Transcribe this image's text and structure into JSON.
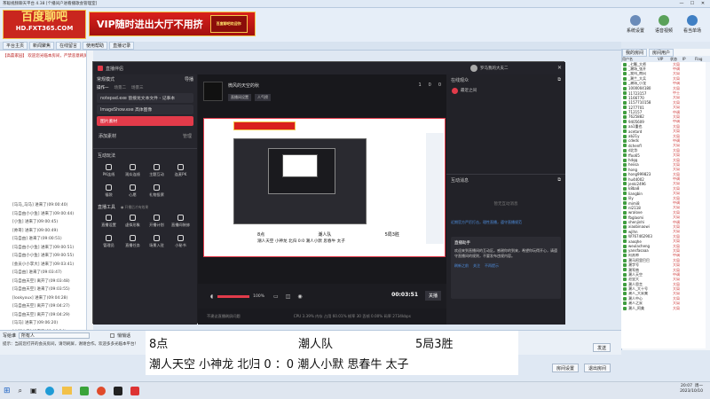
{
  "app": {
    "title": "茶聪视频聊天平台 4.38 [个播间户进看播歌会管理室]",
    "logo_line1": "百度聊吧",
    "logo_line2": "HD.FXT365.COM",
    "promo_main": "VIP随时进出大厅不用挤",
    "promo_sub": "百度聊吧欢迎你"
  },
  "toptools": [
    {
      "label": "系统设置",
      "icon": "gear-icon"
    },
    {
      "label": "语音视频",
      "icon": "headset-icon"
    },
    {
      "label": "看当单场",
      "icon": "tv-icon"
    }
  ],
  "tabs": [
    "平台主页",
    "新闻聚焦",
    "在线留言",
    "使用帮助",
    "直播记录"
  ],
  "room_header": "【高磊家园】 欢迎您光临本房间，严禁恶意刷屏",
  "chat_lines": [
    "[马马_马马] 进来了(09:00:40)",
    "[马自由小小鱼] 进来了(09:00:44)",
    "[小鱼] 进来了(09:00:45)",
    "[帅哥] 进来了(09:00:49)",
    "[马自由] 进来了(09:00:51)",
    "[马自由小小鱼] 进来了(09:00:51)",
    "[马自由小小鱼] 进来了(09:00:55)",
    "[会员小小李大] 进来了(09:03:41)",
    "[马自由] 进来了(09:03:47)",
    "[马自由天空] 离开了(09:03:48)",
    "[马自由天空] 进来了(09:03:55)",
    "[lookyoux] 进来了(09:04:28)",
    "[马自由天空] 离开了(09:04:27)",
    "[马自由天空] 离开了(09:04:29)",
    "[马马] 进来了(09:06:20)",
    "[中国小马] 进来了(09:06:34)",
    "[qq7726000827] 进来了(09:06:36)",
    "[马天鸟鸟] 进来了(09:06:46)"
  ],
  "bottom": {
    "recipient_label": "写给谁",
    "recipient_value": "所有人",
    "private_label": "悄悄话",
    "hint": "提示：当前您打开的会员房间，请勿刷屏，谢谢合作。欢迎多多光临本平台！",
    "send_button": "发送",
    "room_settings": "房间设置",
    "exit_room": "退出房间"
  },
  "right_panel": {
    "tabs": [
      "我的房间",
      "房间用户"
    ],
    "col_headers": [
      "用户名",
      "VIP",
      "状态",
      "IP",
      "Flag"
    ],
    "users": [
      {
        "name": "_七颗_大师",
        "tag": "大局"
      },
      {
        "name": "_潮场_张开",
        "tag": "中调"
      },
      {
        "name": "_我叫_南风",
        "tag": "大局"
      },
      {
        "name": "_潮兰_大兵",
        "tag": "大局"
      },
      {
        "name": "_潮场_小龙",
        "tag": "中调"
      },
      {
        "name": "1000004180",
        "tag": "大局"
      },
      {
        "name": "11723157",
        "tag": "中士"
      },
      {
        "name": "1166770",
        "tag": "大局"
      },
      {
        "name": "1157710158",
        "tag": "大局"
      },
      {
        "name": "1277701",
        "tag": "大局"
      },
      {
        "name": "712157",
        "tag": "中调"
      },
      {
        "name": "7625882",
        "tag": "大局"
      },
      {
        "name": "9405609",
        "tag": "中调"
      },
      {
        "name": "aa1重也",
        "tag": "大局"
      },
      {
        "name": "acetard",
        "tag": "大局"
      },
      {
        "name": "ab21y",
        "tag": "大局"
      },
      {
        "name": "cdeds",
        "tag": "中调"
      },
      {
        "name": "dchenfl",
        "tag": "大局"
      },
      {
        "name": "d北华",
        "tag": "大局"
      },
      {
        "name": "ffoo65",
        "tag": "大局"
      },
      {
        "name": "hdqq",
        "tag": "大局"
      },
      {
        "name": "heiisa",
        "tag": "大局"
      },
      {
        "name": "hong",
        "tag": "大局"
      },
      {
        "name": "hong999823",
        "tag": "大局"
      },
      {
        "name": "hu44002",
        "tag": "中调"
      },
      {
        "name": "jenki2496",
        "tag": "大局"
      },
      {
        "name": "k8ba8",
        "tag": "大局"
      },
      {
        "name": "liangbin",
        "tag": "大局"
      },
      {
        "name": "lily",
        "tag": "大局"
      },
      {
        "name": "mimi8",
        "tag": "中调"
      },
      {
        "name": "nl2118",
        "tag": "大局"
      },
      {
        "name": "wralove",
        "tag": "大局"
      },
      {
        "name": "fbglasmi",
        "tag": "大局"
      },
      {
        "name": "shenjinhi",
        "tag": "中调"
      },
      {
        "name": "xiaobinaowi",
        "tag": "大局"
      },
      {
        "name": "wjlhn",
        "tag": "大局"
      },
      {
        "name": "W767462903",
        "tag": "大局"
      },
      {
        "name": "xaoqhe",
        "tag": "大局"
      },
      {
        "name": "weulacheng",
        "tag": "大局"
      },
      {
        "name": "yansfasaaa",
        "tag": "大局"
      },
      {
        "name": "阿苏帅",
        "tag": "中调"
      },
      {
        "name": "潮马阿里巴巴",
        "tag": "大局"
      },
      {
        "name": "潮字号",
        "tag": "大局"
      },
      {
        "name": "潮军南",
        "tag": "大局"
      },
      {
        "name": "潮人天空",
        "tag": "中调"
      },
      {
        "name": "沧里大",
        "tag": "大局"
      },
      {
        "name": "潮人思言",
        "tag": "大局"
      },
      {
        "name": "潮人_大十号",
        "tag": "大局"
      },
      {
        "name": "潮人_大家美",
        "tag": "大局"
      },
      {
        "name": "潮人中心",
        "tag": "大局"
      },
      {
        "name": "潮人之家",
        "tag": "大局"
      },
      {
        "name": "潮人_阿美",
        "tag": "大局"
      }
    ]
  },
  "obs": {
    "title": "直播伴侣",
    "user_label": "罗马我的大夫二",
    "mode_label": "常规模式",
    "guide_label": "导播",
    "tab_ops": "操作一",
    "tab_scene": "场景二",
    "tab_more": "场景三",
    "sources": [
      "notepad.exe 窗接龙文本文件 - 记事本",
      "ImageShow.exe 高体图像",
      "图片素材"
    ],
    "add_source": "添加素材",
    "manage": "管理",
    "interactive": "互动玩法",
    "tools_row1": [
      "PK连线",
      "观众连线",
      "主题互动",
      "连麦PK"
    ],
    "tools_row2": [
      "福袋",
      "心愿",
      "礼物投票"
    ],
    "live_tools": "直播工具",
    "live_tools_hint": "● 开播后才有效果",
    "tools_row3": [
      "直播设置",
      "虚拟形象",
      "开播计划",
      "直播间装修"
    ],
    "tools_row4": [
      "管理员",
      "直播任务",
      "场景入驻",
      "小秘书"
    ],
    "stream_title": "微风的天空的秋",
    "stream_btn1": "直播间设置",
    "stream_btn2": "人气榜",
    "like_count": "1",
    "fans_count": "0",
    "audience_count": "0",
    "online_viewers": "在线观众",
    "viewer_name": "最近之间",
    "interaction": "互动消息",
    "empty_msg": "暂无互动消息",
    "volume": "100%",
    "time": "00:03:51",
    "end_btn": "关播",
    "hint_text": "不建议直播刷屏问题",
    "status": "CPU 3.39%   内存 占用 60.01%   帧率 30   丢帧 0.00%   码率 2734kbps",
    "notice_text": "近期官方严厉打击，理性直播，遵守直播规范",
    "assistant": "直播助手",
    "assistant_text": "欢迎来到直播间的互动区。感谢你的到来，希望你玩得开心，请遵守直播间的规则，不要发布违规内容。",
    "reply_btn1": "刷新之前",
    "reply_btn2": "关注",
    "reply_btn3": "不再提示",
    "scene_title": "主播画面"
  },
  "overlay": {
    "line1": [
      "8点",
      "潮人队",
      "5局3胜"
    ],
    "line2": "潮人天空  小神龙  北归    0  ：0   潮人小默  思春牛  太子",
    "small_line1": [
      "8点",
      "潮人队",
      "5局3胜"
    ],
    "small_line2": "潮人天空 小神龙 北归 0:0 潮人小默 思春牛 太子"
  },
  "taskbar": {
    "time": "20:07",
    "weekday": "周一",
    "date": "2023/10/10"
  }
}
